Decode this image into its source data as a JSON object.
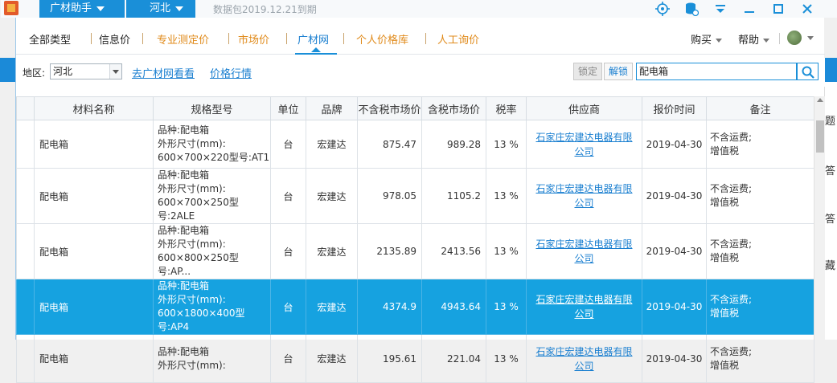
{
  "titlebar": {
    "app_name": "广材助手",
    "region": "河北",
    "data_info": "数据包2019.12.21到期"
  },
  "nav": {
    "items": [
      "全部类型",
      "信息价",
      "专业测定价",
      "市场价",
      "广材网",
      "个人价格库",
      "人工询价"
    ],
    "active": "广材网",
    "buy": "购买",
    "help": "帮助"
  },
  "filter": {
    "region_label": "地区:",
    "region_value": "河北",
    "link_gcw": "去广材网看看",
    "link_trend": "价格行情",
    "lock": "锁定",
    "unlock": "解锁",
    "search_value": "配电箱"
  },
  "table": {
    "headers": [
      "材料名称",
      "规格型号",
      "单位",
      "品牌",
      "不含税市场价",
      "含税市场价",
      "税率",
      "供应商",
      "报价时间",
      "备注"
    ],
    "rows": [
      {
        "name": "配电箱",
        "spec": "品种:配电箱\n外形尺寸(mm):\n600×700×220型号:AT1",
        "unit": "台",
        "brand": "宏建达",
        "price_ex": "875.47",
        "price_in": "989.28",
        "tax": "13 %",
        "supplier": "石家庄宏建达电器有限公司",
        "date": "2019-04-30",
        "note": "不含运费;\n增值税"
      },
      {
        "name": "配电箱",
        "spec": "品种:配电箱\n外形尺寸(mm):\n600×700×250型号:2ALE",
        "unit": "台",
        "brand": "宏建达",
        "price_ex": "978.05",
        "price_in": "1105.2",
        "tax": "13 %",
        "supplier": "石家庄宏建达电器有限公司",
        "date": "2019-04-30",
        "note": "不含运费;\n增值税"
      },
      {
        "name": "配电箱",
        "spec": "品种:配电箱\n外形尺寸(mm):\n600×800×250型号:AP...",
        "unit": "台",
        "brand": "宏建达",
        "price_ex": "2135.89",
        "price_in": "2413.56",
        "tax": "13 %",
        "supplier": "石家庄宏建达电器有限公司",
        "date": "2019-04-30",
        "note": "不含运费;\n增值税"
      },
      {
        "name": "配电箱",
        "spec": "品种:配电箱\n外形尺寸(mm):\n600×1800×400型号:AP4",
        "unit": "台",
        "brand": "宏建达",
        "price_ex": "4374.9",
        "price_in": "4943.64",
        "tax": "13 %",
        "supplier": "石家庄宏建达电器有限公司",
        "date": "2019-04-30",
        "note": "不含运费;\n增值税"
      },
      {
        "name": "配电箱",
        "spec": "品种:配电箱\n外形尺寸(mm):",
        "unit": "台",
        "brand": "宏建达",
        "price_ex": "195.61",
        "price_in": "221.04",
        "tax": "13 %",
        "supplier": "石家庄宏建达电器有限公司",
        "date": "2019-04-30",
        "note": "不含运费;\n增值税"
      }
    ],
    "selected_row": 3
  },
  "side_fragments": [
    "题",
    "答",
    "答",
    "藏"
  ],
  "colors": {
    "accent": "#1a8fd8",
    "selected_row": "#16a2e0",
    "nav_text_orange": "#e08a1a"
  }
}
